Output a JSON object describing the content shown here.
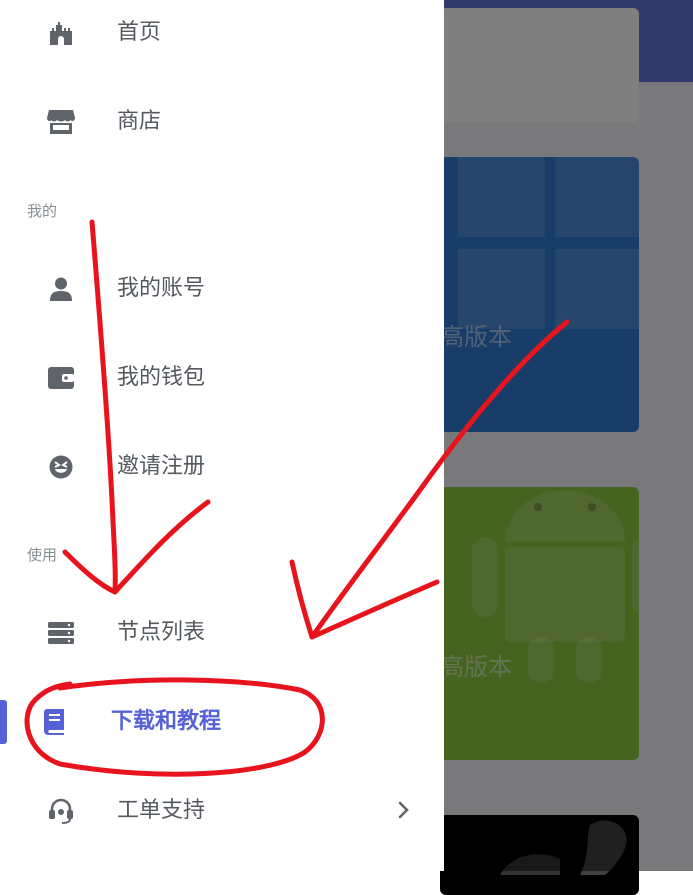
{
  "background": {
    "cards": [
      {
        "text": "高版本"
      },
      {
        "text": "高版本"
      }
    ]
  },
  "drawer": {
    "top_items": [
      {
        "label": "首页",
        "icon": "castle-icon"
      },
      {
        "label": "商店",
        "icon": "store-icon"
      }
    ],
    "sections": [
      {
        "title": "我的",
        "items": [
          {
            "label": "我的账号",
            "icon": "user-icon"
          },
          {
            "label": "我的钱包",
            "icon": "wallet-icon"
          },
          {
            "label": "邀请注册",
            "icon": "smiley-icon"
          }
        ]
      },
      {
        "title": "使用",
        "items": [
          {
            "label": "节点列表",
            "icon": "server-icon"
          },
          {
            "label": "下载和教程",
            "icon": "book-icon",
            "active": true
          },
          {
            "label": "工单支持",
            "icon": "headset-icon",
            "has_chevron": true
          }
        ]
      }
    ]
  },
  "colors": {
    "accent": "#5562d6",
    "annotation": "#e8141d",
    "icon": "#5f646b"
  }
}
